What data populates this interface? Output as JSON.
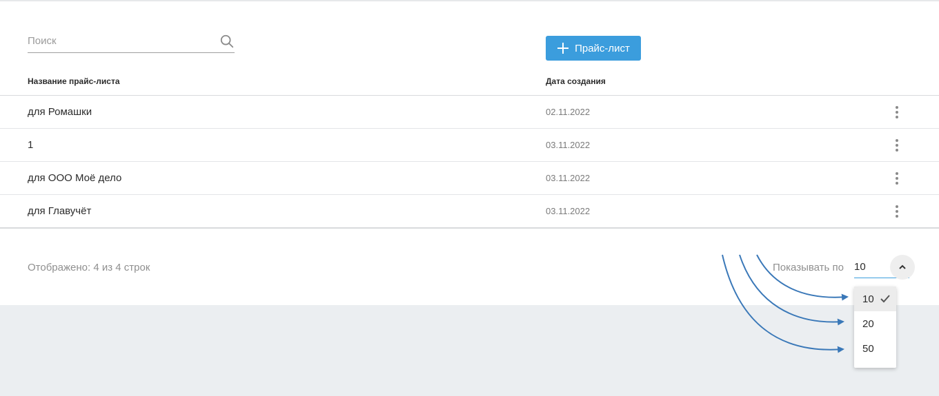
{
  "search": {
    "placeholder": "Поиск",
    "value": ""
  },
  "toolbar": {
    "add_label": "Прайс-лист"
  },
  "table": {
    "headers": {
      "name": "Название прайс-листа",
      "date": "Дата создания"
    },
    "rows": [
      {
        "name": "для Ромашки",
        "date": "02.11.2022"
      },
      {
        "name": "1",
        "date": "03.11.2022"
      },
      {
        "name": "для ООО Моё дело",
        "date": "03.11.2022"
      },
      {
        "name": "для Главучёт",
        "date": "03.11.2022"
      }
    ]
  },
  "footer": {
    "shown": "Отображено: 4 из 4 строк",
    "per_page_label": "Показывать по",
    "per_page_value": "10",
    "options": [
      "10",
      "20",
      "50"
    ]
  },
  "colors": {
    "accent": "#3b9ddd",
    "arrow": "#3a78b8",
    "page_bg": "#ebeef1"
  }
}
